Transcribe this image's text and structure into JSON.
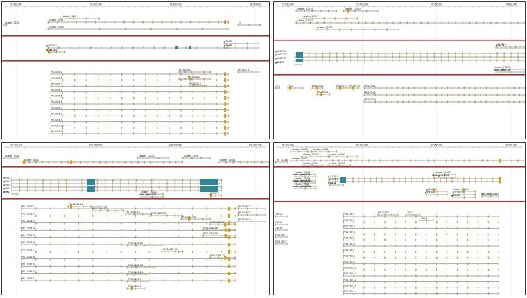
{
  "colors": {
    "exon": "#c8b46e",
    "exon_dark": "#b8a050",
    "utr_blue": "#2b8a9a",
    "highlight": "#d4a017",
    "divider_red": "#c0282f",
    "line": "#555555",
    "grid": "#e2e2e2",
    "text": "#222222"
  },
  "panels": [
    {
      "id": "tl",
      "ruler": [
        "78,550,000",
        "78,600,000",
        "78,650,000",
        "78,700,000"
      ],
      "top_labels": [
        "cluster_9251",
        "cluster_5806",
        "cluster_1654",
        "1"
      ],
      "mid_labels": [
        "g39476.1",
        "g39475.1",
        "g39476",
        "g39475"
      ],
      "bottom_labels": [
        "PB.5026.1",
        "PB.5026.2",
        "PB.5026.3",
        "PB.5026.4",
        "PB.5026.5",
        "PB.5026.6",
        "PB.5026.7",
        "PB.5026.8",
        "PB.5026.9",
        "PB.5026.10",
        "PB.5026.11",
        "PB.5024.1",
        "PB.5024.2",
        "PB.5024.3",
        "PB.5027.1"
      ]
    },
    {
      "id": "tr",
      "ruler": [
        "79,650,000",
        "79,700,000",
        "79,750,000",
        "79,800,000"
      ],
      "top_labels": [
        "cluster_12753",
        "cluster_13260",
        "cluster_15277",
        "cluster_6577",
        "cluster_16390"
      ],
      "mid_labels": [
        "g15477.1",
        "g15477.2",
        "g15477.3",
        "g15477",
        "g15478.1",
        "g15478",
        "cluster_17222",
        "nbis-gene-15"
      ],
      "bottom_labels": [
        "71.1",
        "PB.1970.1",
        "PB.1973.1",
        "PB.1973.2",
        "PB.1975.1",
        "PB.1974.1",
        "PB.1974.2",
        "PB.1974.3"
      ]
    },
    {
      "id": "bl",
      "ruler": [
        "100,100,000",
        "100,150,000",
        "100,200,000",
        "100,250,000"
      ],
      "top_labels": [
        "cluster_3036",
        "cluster_12070",
        "cluster_2109",
        "cluster_10551"
      ],
      "mid_labels": [
        "g9901.1",
        "g9901.2",
        "g9901.3",
        "g9901.4",
        "g9901",
        "cluster_13870",
        "nbis-gene-220",
        "g9902.1",
        "g9902"
      ],
      "bottom_labels": [
        "PB.10281.1",
        "PB.10281.2",
        "PB.10281.3",
        "PB.10281.4",
        "PB.10281.5",
        "PB.10281.6",
        "PB.10281.7",
        "PB.10281.8",
        "PB.10281.9",
        "PB.10281.10",
        "PB.10281.11",
        "PB.10281.12",
        "PB.10281.13",
        "PB.10281.14",
        "PB.10281.15",
        "PB.10281.16",
        "PB.10281.17",
        "PB.10281.18",
        "PB.10281.19",
        "PB.10281.20",
        "PB.10281.21",
        "PB.10281.22",
        "PB.10281.23",
        "PB.10281.24",
        "PB.10283.1",
        "PB.10284.1",
        "PB.10284.2",
        "PB.10284.3",
        "PB.10284.4",
        "PB.10286.1",
        "PB.10282.1",
        "PB.10283.1",
        "PB.10286.1"
      ]
    },
    {
      "id": "br",
      "ruler": [
        "50,000,000",
        "50,100,000",
        "50,150,000",
        "50,200,000"
      ],
      "top_labels": [
        "cluster_20092",
        "cluster_24083",
        "cluster_24081",
        "cluster_12722",
        "cluster_28400",
        "cluster_2645",
        "cluster_24064",
        "on_11018"
      ],
      "mid_labels": [
        "cluster_20091",
        "nbis-gene-5294",
        "cluster_20081",
        "nbis-gene-5293",
        "cluster_2082",
        "nbis-gene-5292",
        "g11182.1",
        "g11182.2",
        "g11182",
        "cluster_21917",
        "nbis-gene-263",
        "g11184.1",
        "g11184",
        "cluster_20890",
        "g11185.1",
        "g11185",
        "nbis-gene-5297"
      ],
      "bottom_labels": [
        "PB.1782.1",
        "PB.1782.2",
        "PB.1782.3",
        "PB.1782.4",
        "PB.1782.5",
        "PB.1782.6",
        "PB.1782.7",
        "PB.1782.8",
        "PB.1782.9",
        "PB.1782.10",
        "PB.1782.11",
        "PB.1782.12",
        "PB.1782.13",
        "PB.1782.14",
        "PB.1782.15",
        "PB.1782.16",
        "PB.1782.17",
        "PB.1780.1",
        "756.1",
        "756.3",
        "756.4",
        "756.5",
        "756.6"
      ]
    }
  ]
}
